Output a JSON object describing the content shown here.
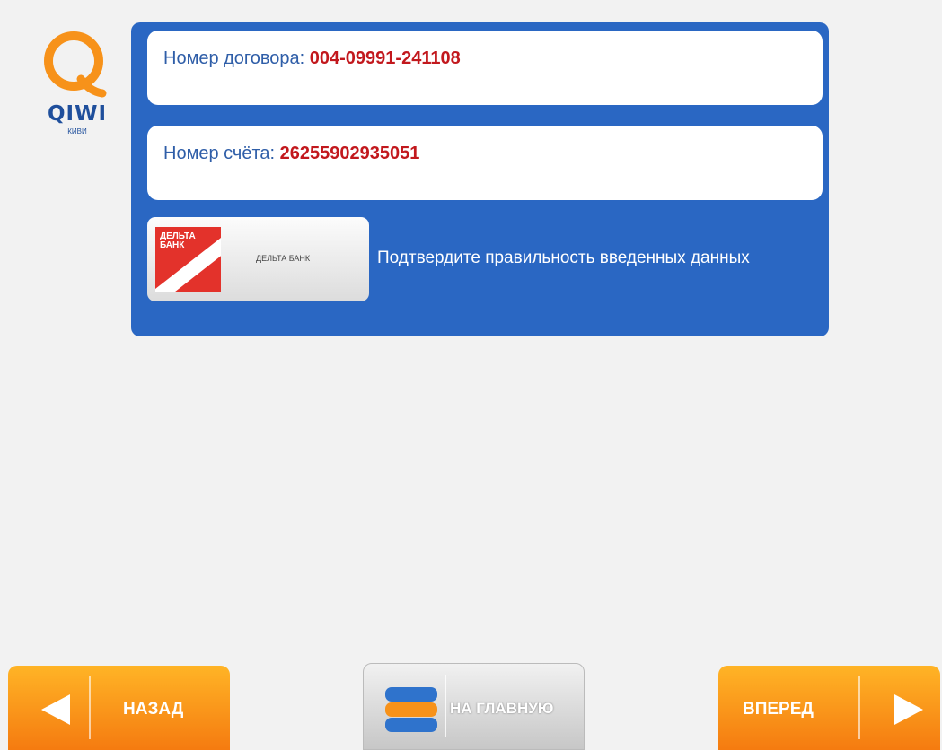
{
  "logo": {
    "brand": "QIWI",
    "sub": "КИВИ"
  },
  "fields": {
    "contract_label": "Номер договора:",
    "contract_value": "004-09991-241108",
    "account_label": "Номер счёта:",
    "account_value": "26255902935051"
  },
  "bank": {
    "logo_text_line1": "ДЕЛЬТА",
    "logo_text_line2": "БАНК",
    "name": "ДЕЛЬТА БАНК"
  },
  "confirm_text": "Подтвердите правильность введенных данных",
  "buttons": {
    "back": "НАЗАД",
    "home": "НА ГЛАВНУЮ",
    "next": "ВПЕРЕД"
  },
  "colors": {
    "panel": "#2a67c3",
    "value": "#c2181d",
    "accent_orange": "#f7921a"
  }
}
